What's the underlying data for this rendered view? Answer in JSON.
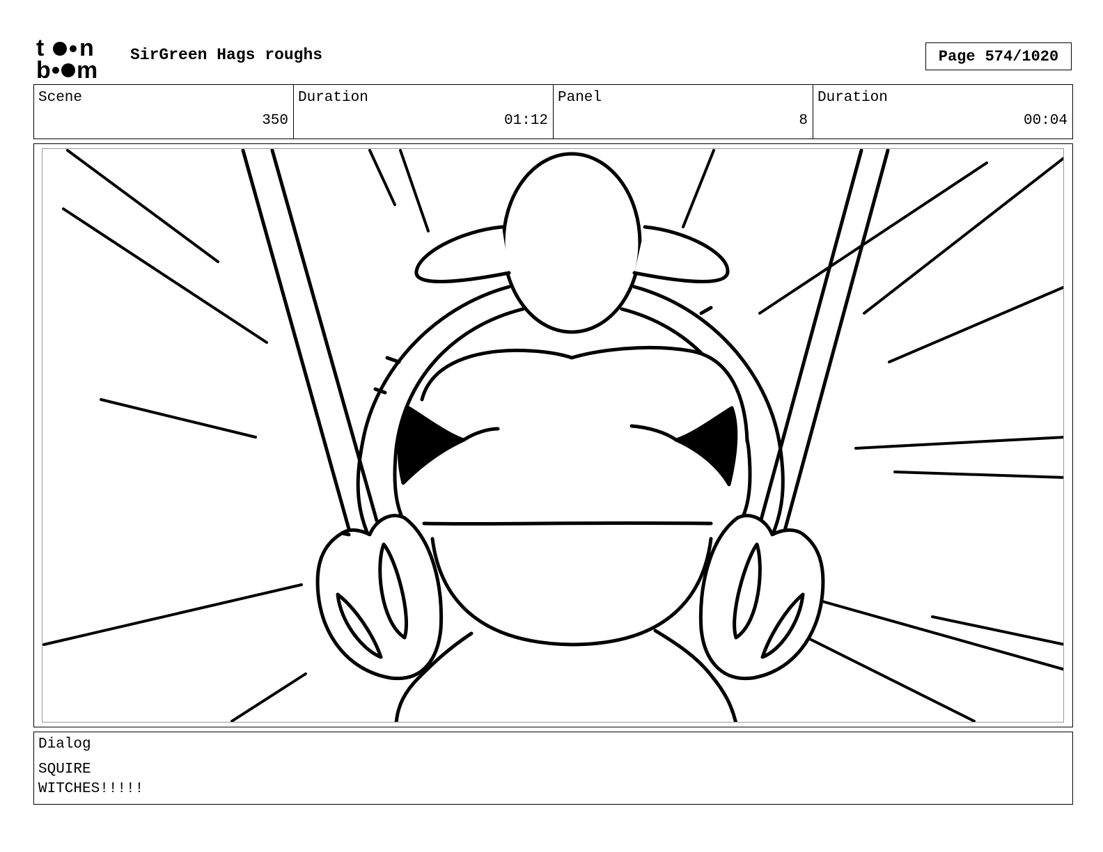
{
  "header": {
    "logo_text_top": "to•n",
    "logo_text_bottom": "b•om",
    "project_title": "SirGreen Hags roughs",
    "page_label": "Page",
    "page_value": "574/1020"
  },
  "info": {
    "scene_label": "Scene",
    "scene_value": "350",
    "scene_duration_label": "Duration",
    "scene_duration_value": "01:12",
    "panel_label": "Panel",
    "panel_value": "8",
    "panel_duration_label": "Duration",
    "panel_duration_value": "00:04"
  },
  "dialog": {
    "label": "Dialog",
    "speaker": "SQUIRE",
    "line": "WITCHES!!!!!"
  }
}
